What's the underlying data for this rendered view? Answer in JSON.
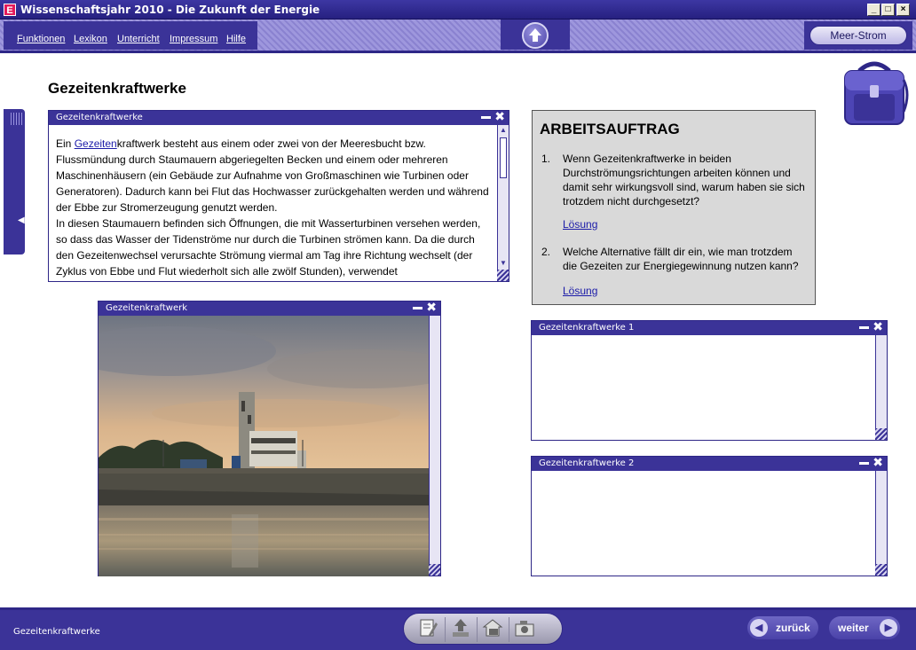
{
  "window": {
    "title": "Wissenschaftsjahr 2010 - Die Zukunft der Energie",
    "app_icon_letter": "E",
    "minimize": "_",
    "maximize": "□",
    "close": "×"
  },
  "menu": {
    "items": [
      "Funktionen",
      "Lexikon",
      "Unterricht",
      "Impressum",
      "Hilfe"
    ],
    "up_icon": "up-arrow-icon",
    "meer_strom_label": "Meer-Strom"
  },
  "page": {
    "title": "Gezeitenkraftwerke"
  },
  "text_panel": {
    "header": "Gezeitenkraftwerke",
    "para1_prefix": "Ein ",
    "para1_link": "Gezeiten",
    "para1_rest": "kraftwerk besteht aus einem oder zwei von der Meeresbucht bzw. Flussmündung durch Staumauern abgeriegelten Becken und einem oder mehreren Maschinenhäusern (ein Gebäude zur Aufnahme von Großmaschinen wie Turbinen oder Generatoren). Dadurch kann bei Flut das Hochwasser zurückgehalten werden und während der Ebbe zur Stromerzeugung genutzt werden.",
    "para2": "In diesen Staumauern befinden sich Öffnungen, die mit Wasserturbinen versehen werden, so dass das Wasser der Tidenströme nur durch die Turbinen strömen kann. Da die durch den Gezeitenwechsel verursachte Strömung viermal am Tag ihre Richtung wechselt (der Zyklus von Ebbe und Flut wiederholt sich alle zwölf Stunden), verwendet"
  },
  "image_panel": {
    "header": "Gezeitenkraftwerk"
  },
  "task": {
    "title": "ARBEITSAUFTRAG",
    "items": [
      {
        "num": "1.",
        "question": "Wenn Gezeitenkraftwerke in beiden Durchströmungsrichtungen arbeiten können und damit sehr wirkungsvoll sind, warum haben sie sich trotzdem nicht durchgesetzt?",
        "link": "Lösung"
      },
      {
        "num": "2.",
        "question": "Welche Alternative fällt dir ein, wie man trotzdem die Gezeiten zur Energiegewinnung nutzen kann?",
        "link": "Lösung"
      }
    ]
  },
  "notes": [
    {
      "header": "Gezeitenkraftwerke 1"
    },
    {
      "header": "Gezeitenkraftwerke 2"
    }
  ],
  "footer": {
    "status": "Gezeitenkraftwerke",
    "tools": [
      "notepad-icon",
      "upload-icon",
      "house-camera-icon",
      "camera-icon"
    ],
    "back_label": "zurück",
    "next_label": "weiter"
  },
  "colors": {
    "primary": "#3b3398",
    "dark": "#2e2787",
    "task_bg": "#d9d9d9",
    "link": "#1b1ba8"
  }
}
